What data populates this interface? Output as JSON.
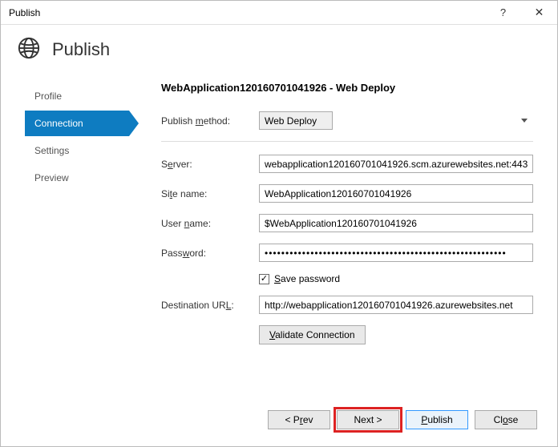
{
  "window": {
    "title": "Publish",
    "help": "?",
    "close": "✕"
  },
  "header": {
    "title": "Publish"
  },
  "sidebar": {
    "items": [
      {
        "label": "Profile"
      },
      {
        "label": "Connection"
      },
      {
        "label": "Settings"
      },
      {
        "label": "Preview"
      }
    ],
    "selectedIndex": 1
  },
  "main": {
    "title": "WebApplication120160701041926 - Web Deploy",
    "publishMethod": {
      "label": "Publish method:",
      "value": "Web Deploy",
      "accel": "m"
    },
    "server": {
      "label": "Server:",
      "value": "webapplication120160701041926.scm.azurewebsites.net:443",
      "accel": "e"
    },
    "siteName": {
      "label": "Site name:",
      "value": "WebApplication120160701041926",
      "accel": "t"
    },
    "userName": {
      "label": "User name:",
      "value": "$WebApplication120160701041926",
      "accel": "n"
    },
    "password": {
      "label": "Password:",
      "masked": "••••••••••••••••••••••••••••••••••••••••••••••••••••••••••",
      "accel": "w"
    },
    "savePassword": {
      "label": "Save password",
      "checked": true,
      "accelText": "S"
    },
    "destinationUrl": {
      "label": "Destination URL:",
      "value": "http://webapplication120160701041926.azurewebsites.net",
      "accel": "L"
    },
    "validate": {
      "label": "Validate Connection",
      "accel": "V"
    }
  },
  "footer": {
    "prev": "< Prev",
    "next": "Next >",
    "publish": "Publish",
    "close": "Close"
  }
}
